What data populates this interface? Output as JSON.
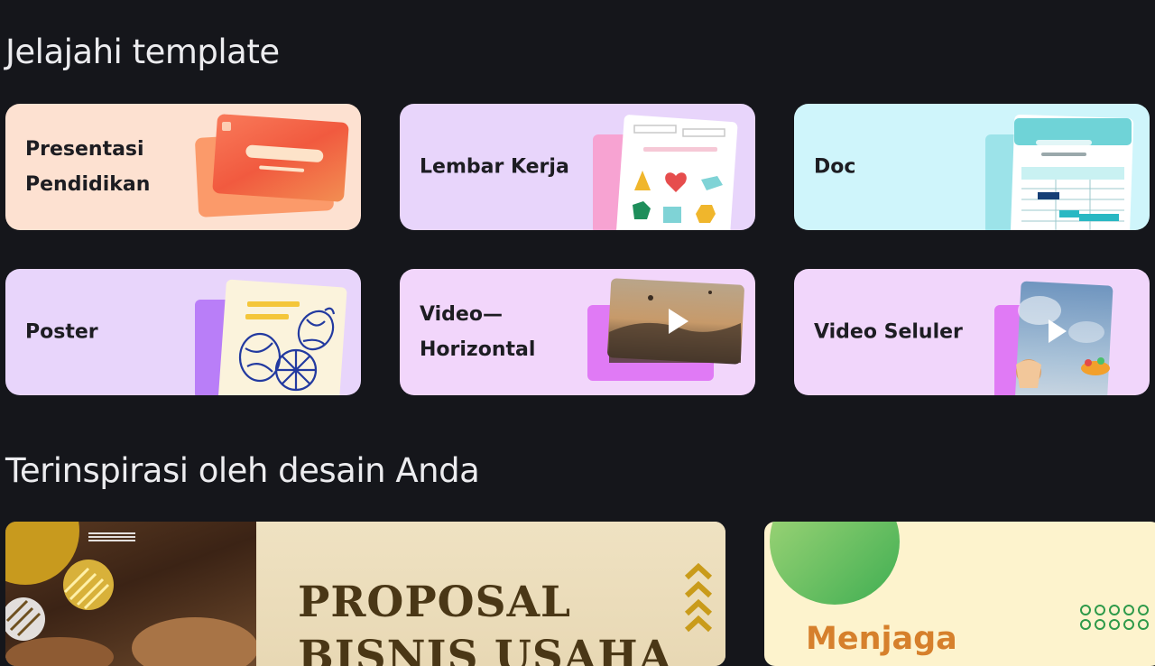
{
  "sections": {
    "explore_title": "Jelajahi template",
    "inspired_title": "Terinspirasi oleh desain Anda"
  },
  "templates": [
    {
      "label": "Presentasi\nPendidikan"
    },
    {
      "label": "Lembar Kerja"
    },
    {
      "label": "Doc"
    },
    {
      "label": "Poster"
    },
    {
      "label": "Video—\nHorizontal"
    },
    {
      "label": "Video Seluler"
    }
  ],
  "designs": [
    {
      "title": "PROPOSAL\nBISNIS USAHA"
    },
    {
      "title": "Menjaga"
    }
  ],
  "colors": {
    "background": "#15161b",
    "presentasi_card": "#fde1d1",
    "lembar_card": "#e8d5fb",
    "doc_card": "#cff5fb",
    "poster_card": "#e8d5fb",
    "video_card": "#f2d6fb",
    "seluler_card": "#f1d6fb"
  },
  "icons": [
    "play-icon",
    "play-icon"
  ]
}
